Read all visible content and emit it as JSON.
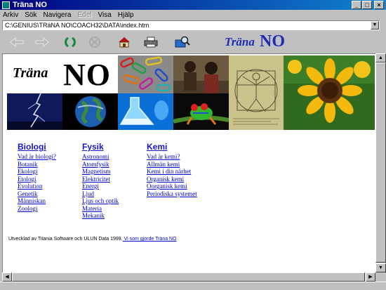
{
  "window": {
    "title": "Träna NO"
  },
  "menu": {
    "items": [
      "Arkiv",
      "Sök",
      "Navigera",
      "Edel",
      "Visa",
      "Hjälp"
    ]
  },
  "address": {
    "value": "C:\\GENIUS\\TRäNA NO\\COACH32\\DATA\\index.htm"
  },
  "toolbar": {
    "icons": [
      "back-arrow-icon",
      "forward-arrow-icon",
      "refresh-icon",
      "stop-icon",
      "home-icon",
      "print-icon",
      "search-book-icon"
    ],
    "brand_italic": "Träna",
    "brand_no": "NO"
  },
  "banner": {
    "logo_trana": "Träna",
    "logo_no": "NO",
    "images": [
      "paperclips-image",
      "children-image",
      "vitruvian-man-image",
      "sunflower-image",
      "lightning-image",
      "earth-image",
      "flask-image",
      "frog-image"
    ]
  },
  "columns": {
    "biologi": {
      "heading": "Biologi",
      "links": [
        "Vad är biologi?",
        "Botanik",
        "Ekologi",
        "Etologi",
        "Evolution",
        "Genetik",
        "Människan",
        "Zoologi"
      ]
    },
    "fysik": {
      "heading": "Fysik",
      "links": [
        "Astronomi",
        "Atomfysik",
        "Magnetism",
        "Elektricitet",
        "Energi",
        "Ljud",
        "Ljus och optik",
        "Materia",
        "Mekanik"
      ]
    },
    "kemi": {
      "heading": "Kemi",
      "links": [
        "Vad är kemi?",
        "Allmän kemi",
        "Kemi i din närhet",
        "Organisk kemi",
        "Oorganisk kemi",
        "Periodiska systemet"
      ]
    }
  },
  "footer": {
    "text": "Utvecklad av Titania Software och ULUN Data 1999.",
    "link": " Vi som gjorde Träna NO"
  },
  "colors": {
    "link": "#0000cc",
    "heading": "#1515c8",
    "brand": "#1d2db5",
    "titlebar": "#000080"
  }
}
